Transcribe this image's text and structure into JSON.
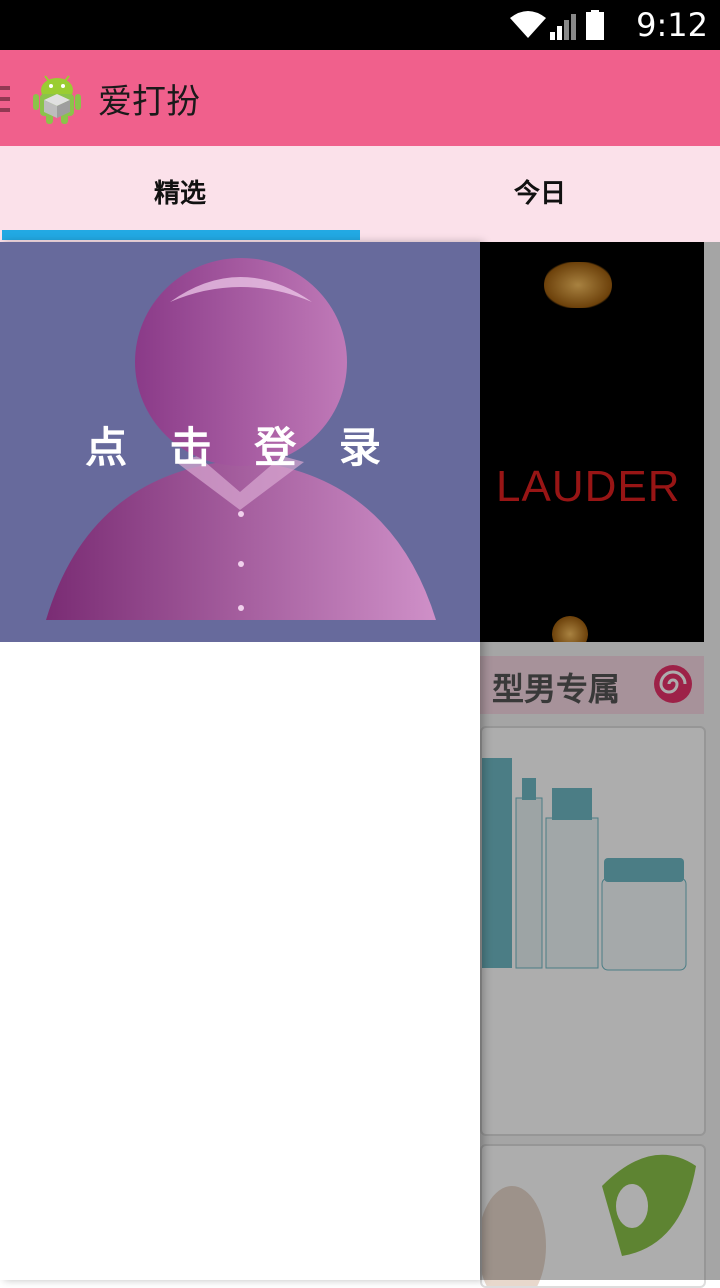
{
  "status_bar": {
    "time": "9:12"
  },
  "app_bar": {
    "title": "爱打扮"
  },
  "tabs": [
    {
      "label": "精选"
    },
    {
      "label": "今日"
    }
  ],
  "drawer": {
    "login_label": "点 击 登 录"
  },
  "content": {
    "banner_text": "LAUDER",
    "section_title": "型男专属"
  },
  "colors": {
    "app_bar": "#f0608c",
    "tabs_bg": "#fbe1ea",
    "tab_indicator": "#22a9e3",
    "drawer_header": "#676a9c"
  }
}
